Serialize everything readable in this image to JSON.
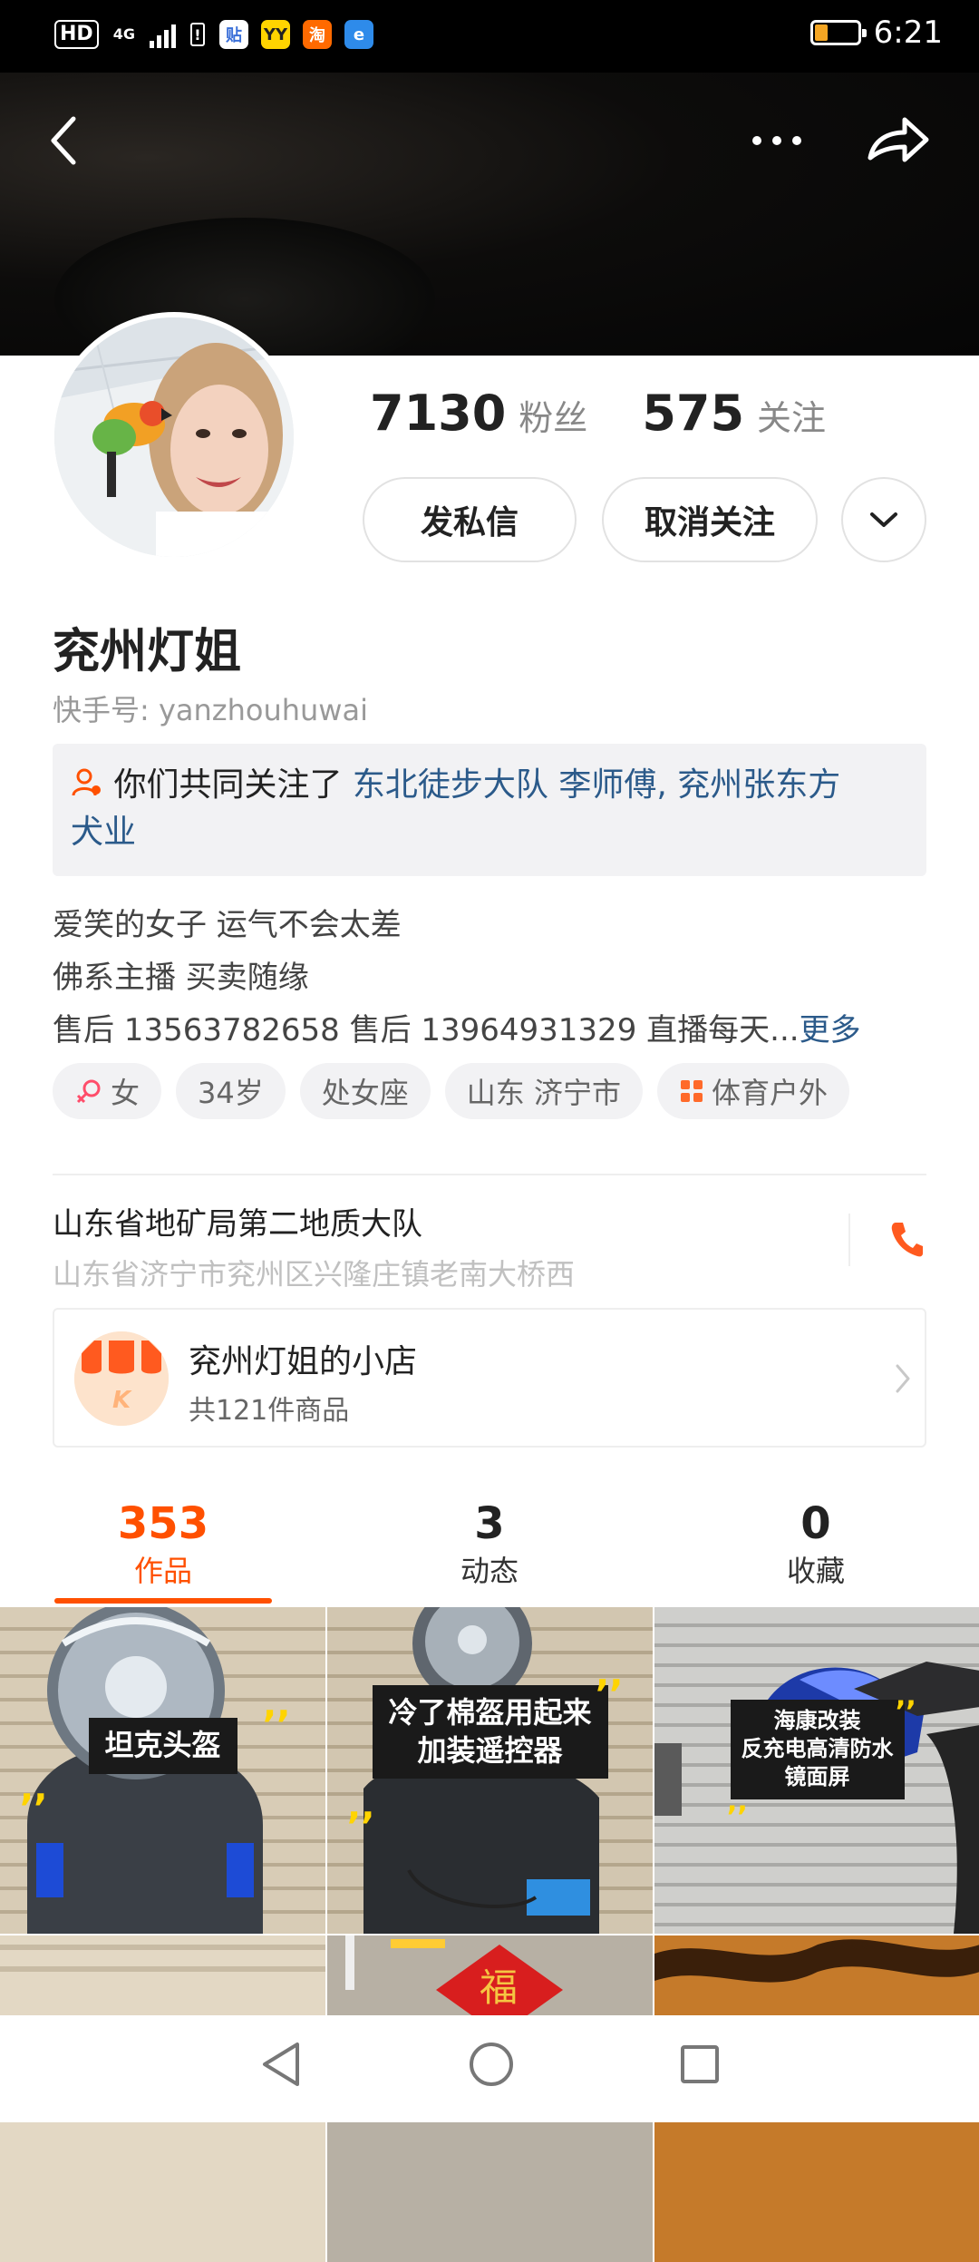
{
  "status_bar": {
    "hd": "HD",
    "network": "4G",
    "app_icons": [
      {
        "name": "tieba-icon",
        "glyph": "贴",
        "bg": "#ffffff",
        "fg": "#3a6fd8"
      },
      {
        "name": "yy-icon",
        "glyph": "YY",
        "bg": "#ffd400",
        "fg": "#222222"
      },
      {
        "name": "taobao-icon",
        "glyph": "淘",
        "bg": "#ff6a00",
        "fg": "#ffffff"
      },
      {
        "name": "browser-icon",
        "glyph": "e",
        "bg": "#2e8bea",
        "fg": "#ffffff"
      }
    ],
    "battery_level": 0.3,
    "time": "6:21"
  },
  "profile": {
    "followers_count": "7130",
    "followers_label": "粉丝",
    "following_count": "575",
    "following_label": "关注",
    "message_button": "发私信",
    "unfollow_button": "取消关注",
    "name": "兖州灯姐",
    "kuaishou_id": "快手号: yanzhouhuwai"
  },
  "mutual": {
    "prefix": "你们共同关注了 ",
    "names_line1": "东北徒步大队 李师傅, 兖州张东方",
    "names_line2": "犬业"
  },
  "bio": {
    "line1": "爱笑的女子 运气不会太差",
    "line2": "佛系主播   买卖随缘",
    "line3": "售后 13563782658 售后 13964931329 直播每天...",
    "more": "更多"
  },
  "tags": {
    "gender": "女",
    "age": "34岁",
    "zodiac": "处女座",
    "location": "山东 济宁市",
    "interest": "体育户外"
  },
  "address": {
    "title": "山东省地矿局第二地质大队",
    "detail": "山东省济宁市兖州区兴隆庄镇老南大桥西"
  },
  "shop": {
    "title": "兖州灯姐的小店",
    "subtitle": "共121件商品"
  },
  "content_tabs": [
    {
      "count": "353",
      "label": "作品"
    },
    {
      "count": "3",
      "label": "动态"
    },
    {
      "count": "0",
      "label": "收藏"
    }
  ],
  "videos": {
    "v1": "坦克头盔",
    "v2_line1": "冷了棉盔用起来",
    "v2_line2": "加装遥控器",
    "v3_line1": "海康改装",
    "v3_line2": "反充电高清防水",
    "v3_line3": "镜面屏"
  },
  "colors": {
    "accent": "#ff5000",
    "link": "#2b5a8a",
    "caption_quote": "#ffd400"
  }
}
